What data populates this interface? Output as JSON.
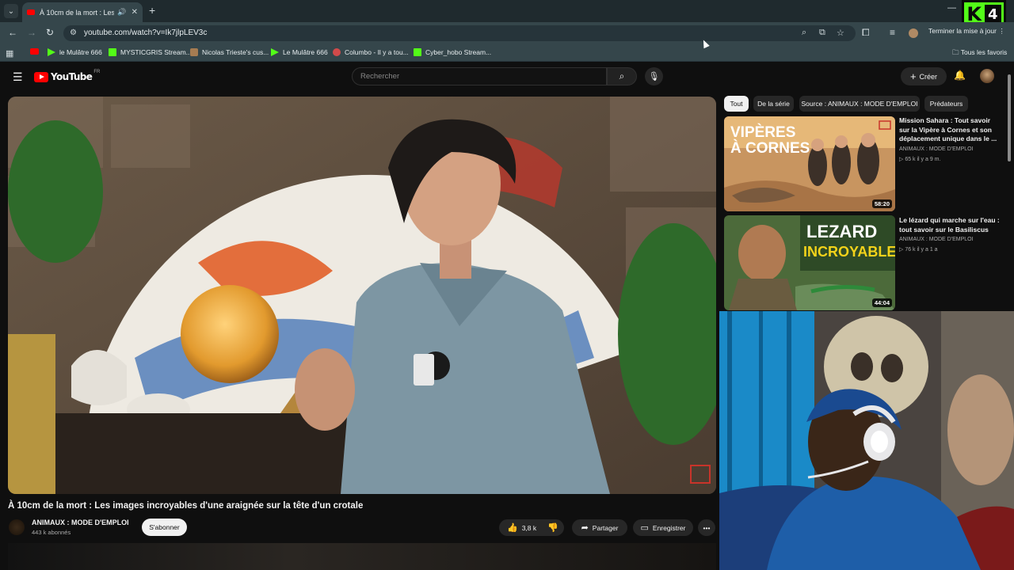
{
  "browser": {
    "tab": {
      "title": "À 10cm de la mort : Les images incroyables d'une araignée sur la tête d'un crotale"
    },
    "new_tab_icon": "plus-icon",
    "url": "youtube.com/watch?v=Ik7jlpLEV3c",
    "update_label": "Terminer la mise à jour",
    "bookmarks": [
      {
        "label": "",
        "icon": "youtube"
      },
      {
        "label": "le Mulâtre 666",
        "icon": "play"
      },
      {
        "label": "MYSTICGRIS Stream...",
        "icon": "kick"
      },
      {
        "label": "Nicolas Trieste's cus...",
        "icon": "brown"
      },
      {
        "label": "Le Mulâtre 666",
        "icon": "play"
      },
      {
        "label": "Columbo - Il y a tou...",
        "icon": "red"
      },
      {
        "label": "Cyber_hobo Stream...",
        "icon": "kick"
      }
    ],
    "all_bookmarks_label": "Tous les favoris"
  },
  "overlay": {
    "badge_letter": "K",
    "badge_number": "4"
  },
  "youtube": {
    "logo_text": "YouTube",
    "logo_region": "FR",
    "search_placeholder": "Rechercher",
    "create_label": "Créer"
  },
  "video": {
    "title": "À 10cm de la mort : Les images incroyables d'une araignée sur la tête d'un crotale",
    "channel": "ANIMAUX : MODE D'EMPLOI",
    "subscribers": "443 k abonnés",
    "subscribe_label": "S'abonner",
    "likes": "3,8 k",
    "share_label": "Partager",
    "save_label": "Enregistrer"
  },
  "chips": [
    "Tout",
    "De la série",
    "Source : ANIMAUX : MODE D'EMPLOI",
    "Prédateurs"
  ],
  "recommendations": [
    {
      "title": "Mission Sahara : Tout savoir sur la Vipère à Cornes et son déplacement unique dans le ...",
      "channel": "ANIMAUX : MODE D'EMPLOI",
      "meta": "65 k  il y a 9 m.",
      "duration": "58:20",
      "thumb_text_1": "VIPÈRES",
      "thumb_text_2": "À CORNES"
    },
    {
      "title": "Le lézard qui marche sur l'eau : tout savoir sur le Basiliscus",
      "channel": "ANIMAUX : MODE D'EMPLOI",
      "meta": "76 k  il y a 1 a",
      "duration": "44:04",
      "thumb_text_1": "LEZARD",
      "thumb_text_2": "INCROYABLE"
    }
  ],
  "colors": {
    "chrome_toolbar": "#35464b",
    "youtube_red": "#ff0000",
    "kick_green": "#53fc18",
    "page_bg": "#0f0f0f"
  }
}
